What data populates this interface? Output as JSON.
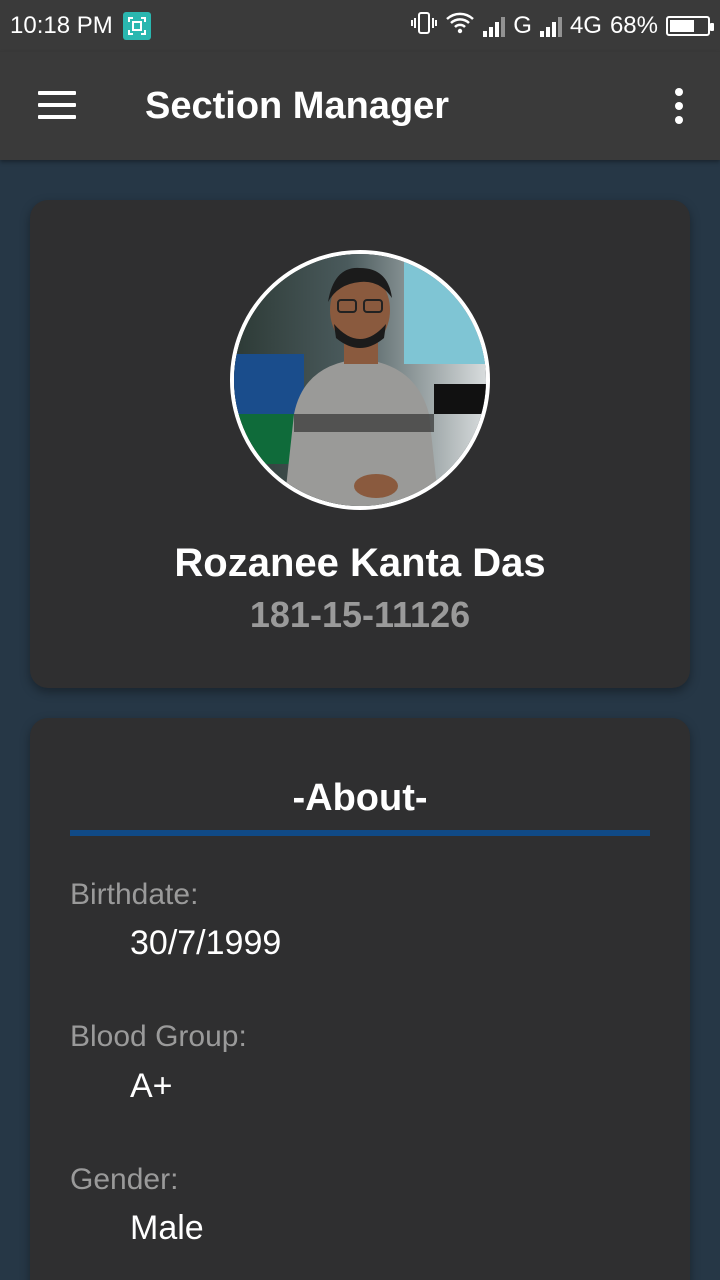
{
  "status_bar": {
    "time": "10:18 PM",
    "network_1": "G",
    "network_2": "4G",
    "battery_percent": "68%",
    "battery_level": 0.68,
    "icons": [
      "screen-capture-icon",
      "vibrate-icon",
      "wifi-icon",
      "signal-icon",
      "battery-icon"
    ]
  },
  "app_bar": {
    "title": "Section Manager",
    "menu_icon": "hamburger-menu-icon",
    "overflow_icon": "more-vert-icon"
  },
  "profile": {
    "name": "Rozanee Kanta Das",
    "student_id": "181-15-11126"
  },
  "about": {
    "title": "-About-",
    "accent_color": "#104a86",
    "fields": [
      {
        "label": "Birthdate:",
        "value": "30/7/1999"
      },
      {
        "label": "Blood Group:",
        "value": "A+"
      },
      {
        "label": "Gender:",
        "value": "Male"
      }
    ]
  },
  "colors": {
    "background": "#263746",
    "bars": "#3a3a3a",
    "card": "#2f2f30",
    "muted_text": "#9a9a9a"
  }
}
